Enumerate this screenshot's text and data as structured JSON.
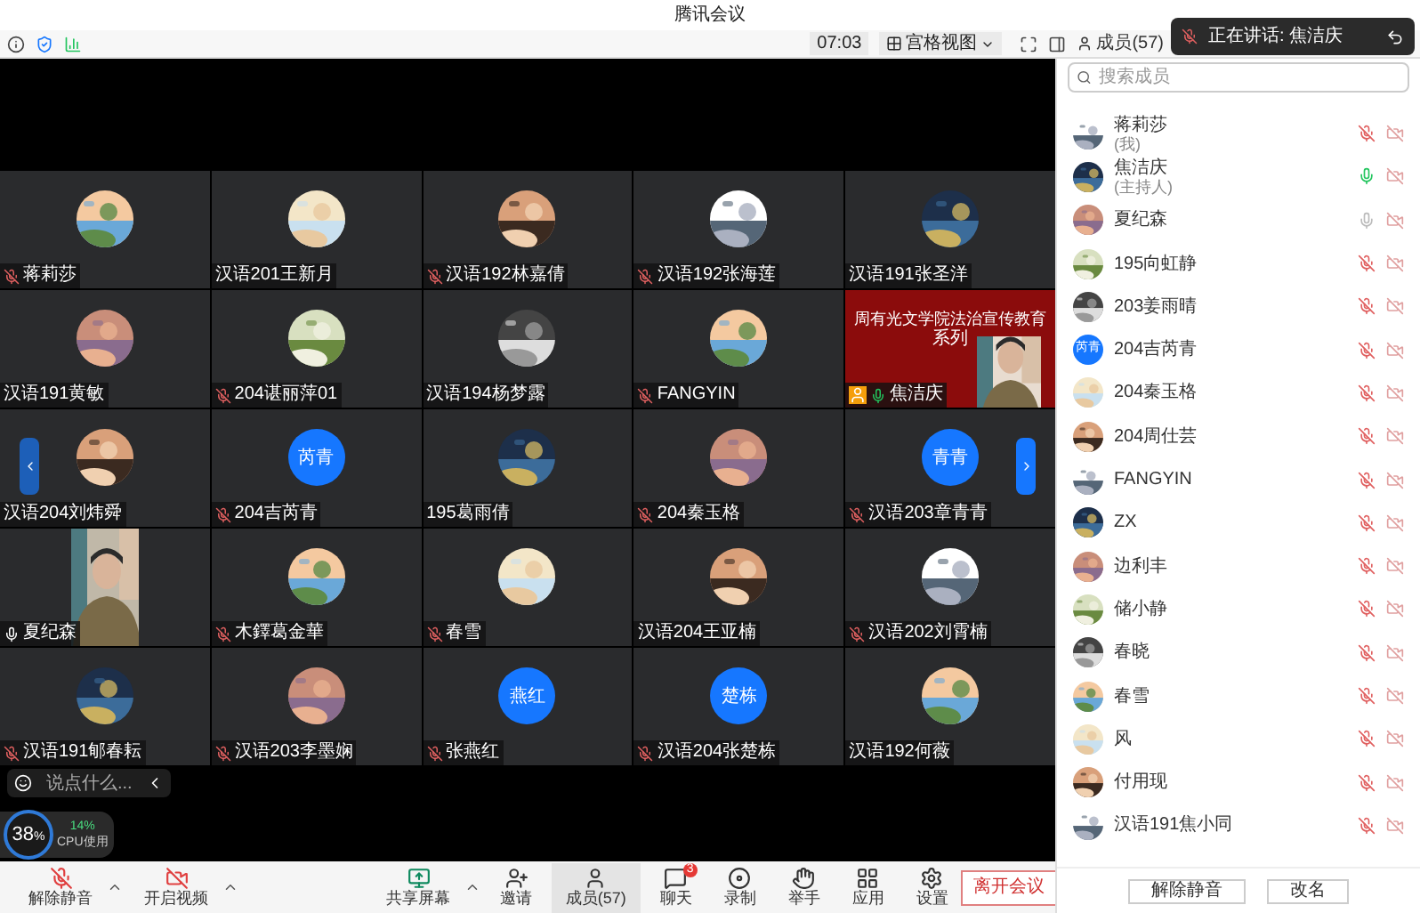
{
  "window": {
    "title": "腾讯会议"
  },
  "top_bar": {
    "timer": "07:03",
    "view_label": "宫格视图",
    "members_label": "成员(57)"
  },
  "speaking_toast": {
    "text": "正在讲话: 焦洁庆"
  },
  "tiles": [
    {
      "name": "蒋莉莎",
      "muted": true,
      "speaking": false,
      "mic_open": false,
      "kind": "picture"
    },
    {
      "name": "汉语201王新月",
      "muted": false,
      "speaking": false,
      "mic_open": false,
      "kind": "picture"
    },
    {
      "name": "汉语192林嘉倩",
      "muted": true,
      "speaking": false,
      "mic_open": false,
      "kind": "picture"
    },
    {
      "name": "汉语192张海莲",
      "muted": true,
      "speaking": false,
      "mic_open": false,
      "kind": "picture"
    },
    {
      "name": "汉语191张圣洋",
      "muted": false,
      "speaking": false,
      "mic_open": false,
      "kind": "picture"
    },
    {
      "name": "汉语191黄敏",
      "muted": false,
      "speaking": false,
      "mic_open": false,
      "kind": "picture"
    },
    {
      "name": "204谌丽萍01",
      "muted": true,
      "speaking": false,
      "mic_open": false,
      "kind": "picture"
    },
    {
      "name": "汉语194杨梦露",
      "muted": false,
      "speaking": false,
      "mic_open": false,
      "kind": "picture"
    },
    {
      "name": "FANGYIN",
      "muted": true,
      "speaking": false,
      "mic_open": false,
      "kind": "picture"
    },
    {
      "name": "焦洁庆",
      "muted": false,
      "speaking": true,
      "mic_open": false,
      "kind": "slide",
      "host": true,
      "slide_title": "周有光文学院法治宣传教育",
      "slide_line2": "系列"
    },
    {
      "name": "汉语204刘炜舜",
      "muted": false,
      "speaking": false,
      "mic_open": false,
      "kind": "picture"
    },
    {
      "name": "204吉芮青",
      "muted": true,
      "speaking": false,
      "mic_open": false,
      "kind": "initials",
      "initials": "芮青"
    },
    {
      "name": "195葛雨倩",
      "muted": false,
      "speaking": false,
      "mic_open": false,
      "kind": "picture"
    },
    {
      "name": "204秦玉格",
      "muted": true,
      "speaking": false,
      "mic_open": false,
      "kind": "picture"
    },
    {
      "name": "汉语203章青青",
      "muted": true,
      "speaking": false,
      "mic_open": false,
      "kind": "initials",
      "initials": "青青"
    },
    {
      "name": "夏纪森",
      "muted": false,
      "speaking": false,
      "mic_open": true,
      "kind": "video"
    },
    {
      "name": "木鐸葛金華",
      "muted": true,
      "speaking": false,
      "mic_open": false,
      "kind": "picture"
    },
    {
      "name": "春雪",
      "muted": true,
      "speaking": false,
      "mic_open": false,
      "kind": "picture"
    },
    {
      "name": "汉语204王亚楠",
      "muted": false,
      "speaking": false,
      "mic_open": false,
      "kind": "picture"
    },
    {
      "name": "汉语202刘霄楠",
      "muted": true,
      "speaking": false,
      "mic_open": false,
      "kind": "picture"
    },
    {
      "name": "汉语191郇春耘",
      "muted": true,
      "speaking": false,
      "mic_open": false,
      "kind": "picture"
    },
    {
      "name": "汉语203李墨娴",
      "muted": true,
      "speaking": false,
      "mic_open": false,
      "kind": "picture"
    },
    {
      "name": "张燕红",
      "muted": true,
      "speaking": false,
      "mic_open": false,
      "kind": "initials",
      "initials": "燕红"
    },
    {
      "name": "汉语204张楚栋",
      "muted": true,
      "speaking": false,
      "mic_open": false,
      "kind": "initials",
      "initials": "楚栋"
    },
    {
      "name": "汉语192何薇",
      "muted": false,
      "speaking": false,
      "mic_open": false,
      "kind": "picture"
    }
  ],
  "chat_input": {
    "placeholder": "说点什么..."
  },
  "cpu": {
    "total": "38",
    "unit": "%",
    "app": "14%",
    "label": "CPU使用"
  },
  "toolbar": [
    {
      "kind": "mic",
      "label": "解除静音",
      "menu": true,
      "selected": false
    },
    {
      "kind": "video",
      "label": "开启视频",
      "menu": true,
      "selected": false
    },
    {
      "kind": "share",
      "label": "共享屏幕",
      "menu": true,
      "selected": false
    },
    {
      "kind": "invite",
      "label": "邀请",
      "menu": false,
      "selected": false
    },
    {
      "kind": "members",
      "label": "成员(57)",
      "menu": false,
      "selected": true
    },
    {
      "kind": "chat",
      "label": "聊天",
      "menu": false,
      "badge": "3",
      "selected": false
    },
    {
      "kind": "record",
      "label": "录制",
      "menu": false,
      "selected": false
    },
    {
      "kind": "hand",
      "label": "举手",
      "menu": false,
      "selected": false
    },
    {
      "kind": "apps",
      "label": "应用",
      "menu": false,
      "selected": false
    },
    {
      "kind": "settings",
      "label": "设置",
      "menu": false,
      "selected": false
    }
  ],
  "leave_button": "离开会议",
  "members_panel": {
    "search_placeholder": "搜索成员",
    "members": [
      {
        "name": "蒋莉莎",
        "note": "(我)",
        "muted": true,
        "speaking": false
      },
      {
        "name": "焦洁庆",
        "note": "(主持人)",
        "muted": false,
        "speaking": true
      },
      {
        "name": "夏纪森",
        "muted": false,
        "speaking": false
      },
      {
        "name": "195向虹静",
        "muted": true,
        "speaking": false
      },
      {
        "name": "203姜雨晴",
        "muted": true,
        "speaking": false
      },
      {
        "name": "204吉芮青",
        "muted": true,
        "speaking": false,
        "initials": "芮青"
      },
      {
        "name": "204秦玉格",
        "muted": true,
        "speaking": false
      },
      {
        "name": "204周仕芸",
        "muted": true,
        "speaking": false
      },
      {
        "name": "FANGYIN",
        "muted": true,
        "speaking": false
      },
      {
        "name": "ZX",
        "muted": true,
        "speaking": false
      },
      {
        "name": "边利丰",
        "muted": true,
        "speaking": false
      },
      {
        "name": "储小静",
        "muted": true,
        "speaking": false
      },
      {
        "name": "春晓",
        "muted": true,
        "speaking": false
      },
      {
        "name": "春雪",
        "muted": true,
        "speaking": false
      },
      {
        "name": "风",
        "muted": true,
        "speaking": false
      },
      {
        "name": "付用现",
        "muted": true,
        "speaking": false
      },
      {
        "name": "汉语191焦小同",
        "muted": true,
        "speaking": false
      }
    ],
    "buttons": [
      "解除静音",
      "改名"
    ]
  }
}
